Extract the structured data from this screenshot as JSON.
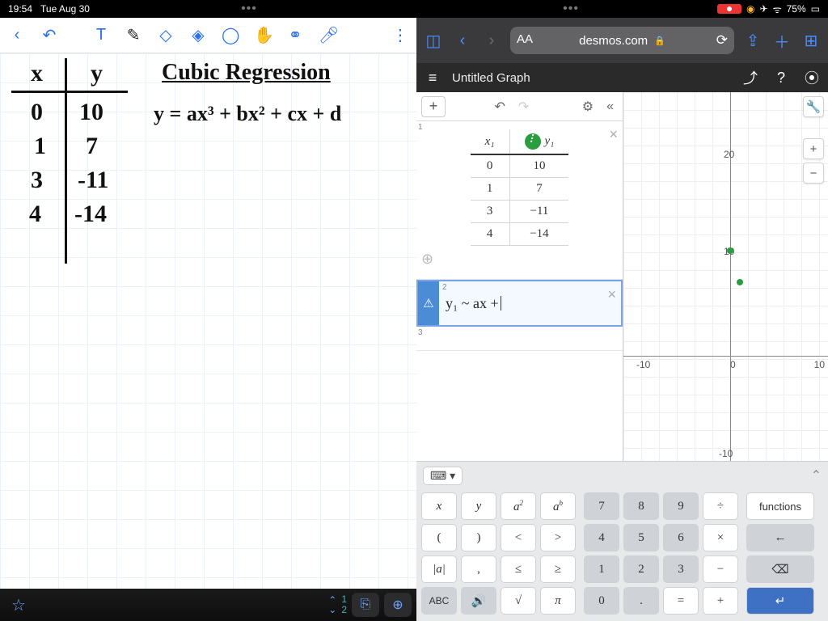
{
  "statusbar": {
    "time": "19:54",
    "date": "Tue Aug 30",
    "battery": "75%"
  },
  "notes": {
    "title": "Cubic  Regression",
    "equation": "y = ax³ + bx² + cx + d",
    "table_header": {
      "x": "x",
      "y": "y"
    },
    "rows": [
      {
        "x": "0",
        "y": "10"
      },
      {
        "x": "1",
        "y": "7"
      },
      {
        "x": "3",
        "y": "-11"
      },
      {
        "x": "4",
        "y": "-14"
      }
    ],
    "page_current": "1",
    "page_total": "2"
  },
  "safari": {
    "url": "desmos.com",
    "lock": "🔒"
  },
  "desmos": {
    "title": "Untitled Graph",
    "table_head": {
      "x": "x₁",
      "y": "y₁"
    },
    "table_rows": [
      {
        "x": "0",
        "y": "10"
      },
      {
        "x": "1",
        "y": "7"
      },
      {
        "x": "3",
        "y": "−11"
      },
      {
        "x": "4",
        "y": "−14"
      }
    ],
    "regression_expr": "y₁ ~ ax  +",
    "axis": {
      "xneg": "-10",
      "zero": "0",
      "xpos": "10",
      "y20": "20",
      "y10": "10",
      "yneg10": "-10"
    }
  },
  "chart_data": {
    "type": "scatter",
    "title": "",
    "xlabel": "",
    "ylabel": "",
    "xlim": [
      -12,
      12
    ],
    "ylim": [
      -15,
      22
    ],
    "series": [
      {
        "name": "y₁",
        "x": [
          0,
          1,
          3,
          4
        ],
        "y": [
          10,
          7,
          -11,
          -14
        ]
      }
    ]
  },
  "keyboard": {
    "math": [
      [
        "x",
        "y",
        "a²",
        "aᵇ"
      ],
      [
        "(",
        ")",
        "<",
        ">"
      ],
      [
        "|a|",
        ",",
        "≤",
        "≥"
      ],
      [
        "ABC",
        "🔊",
        "√",
        "π"
      ]
    ],
    "nums": [
      [
        "7",
        "8",
        "9",
        "÷"
      ],
      [
        "4",
        "5",
        "6",
        "×"
      ],
      [
        "1",
        "2",
        "3",
        "−"
      ],
      [
        "0",
        ".",
        "=",
        "+"
      ]
    ],
    "right": [
      "functions",
      "←",
      "⌫",
      "↵"
    ]
  }
}
